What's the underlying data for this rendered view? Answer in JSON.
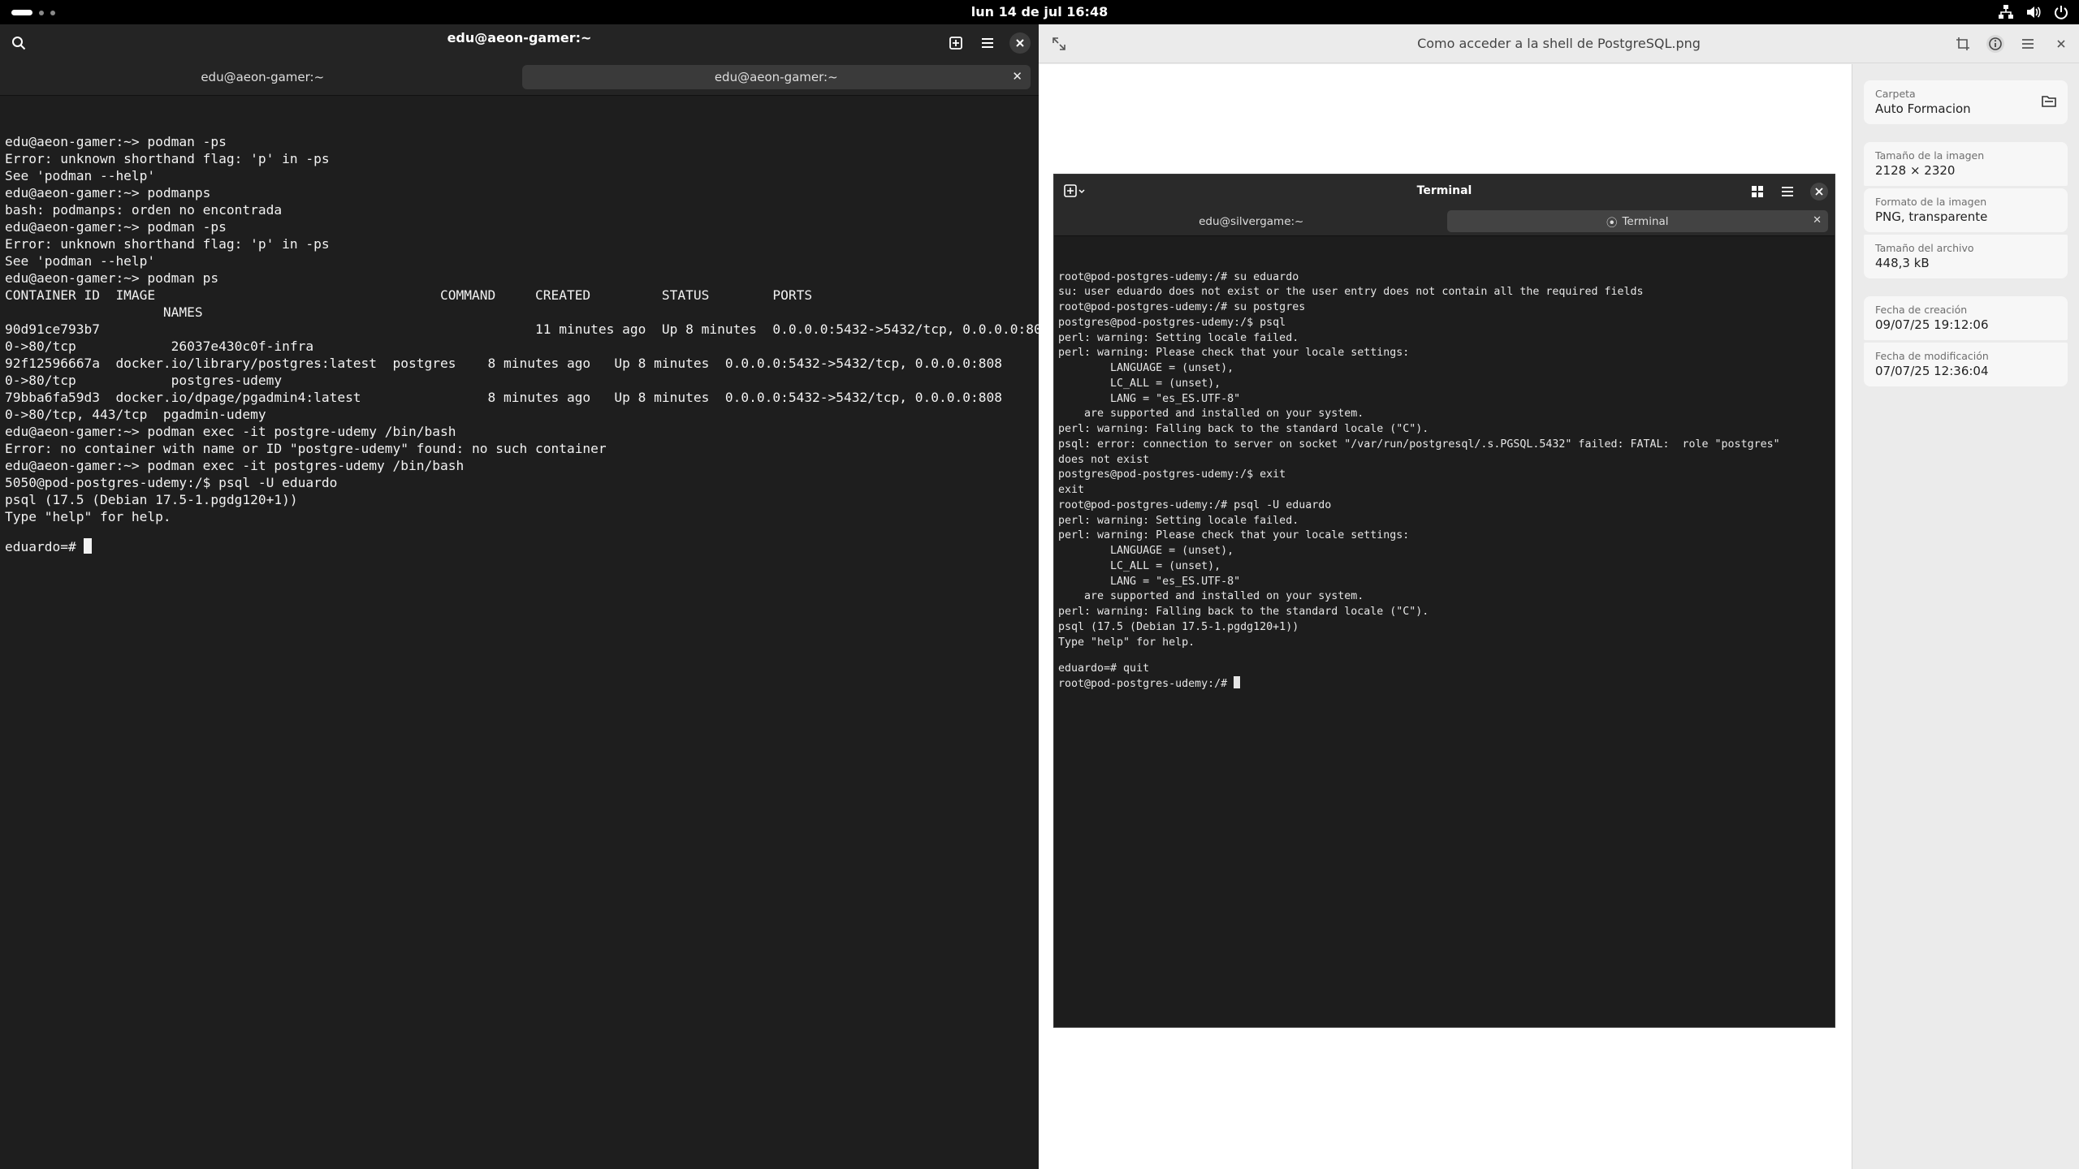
{
  "topbar": {
    "clock": "lun 14 de jul  16:48",
    "icons": [
      "network-icon",
      "volume-icon",
      "power-icon"
    ]
  },
  "terminal": {
    "title": "edu@aeon-gamer:~",
    "tabs": [
      {
        "label": "edu@aeon-gamer:~",
        "active": false
      },
      {
        "label": "edu@aeon-gamer:~",
        "active": true
      }
    ],
    "lines": [
      "edu@aeon-gamer:~> podman -ps",
      "Error: unknown shorthand flag: 'p' in -ps",
      "See 'podman --help'",
      "edu@aeon-gamer:~> podmanps",
      "bash: podmanps: orden no encontrada",
      "edu@aeon-gamer:~> podman -ps",
      "Error: unknown shorthand flag: 'p' in -ps",
      "See 'podman --help'",
      "edu@aeon-gamer:~> podman ps",
      "CONTAINER ID  IMAGE                                    COMMAND     CREATED         STATUS        PORTS",
      "                    NAMES",
      "90d91ce793b7                                                       11 minutes ago  Up 8 minutes  0.0.0.0:5432->5432/tcp, 0.0.0.0:808",
      "0->80/tcp            26037e430c0f-infra",
      "92f12596667a  docker.io/library/postgres:latest  postgres    8 minutes ago   Up 8 minutes  0.0.0.0:5432->5432/tcp, 0.0.0.0:808",
      "0->80/tcp            postgres-udemy",
      "79bba6fa59d3  docker.io/dpage/pgadmin4:latest                8 minutes ago   Up 8 minutes  0.0.0.0:5432->5432/tcp, 0.0.0.0:808",
      "0->80/tcp, 443/tcp  pgadmin-udemy",
      "edu@aeon-gamer:~> podman exec -it postgre-udemy /bin/bash",
      "Error: no container with name or ID \"postgre-udemy\" found: no such container",
      "edu@aeon-gamer:~> podman exec -it postgres-udemy /bin/bash",
      "5050@pod-postgres-udemy:/$ psql -U eduardo",
      "psql (17.5 (Debian 17.5-1.pgdg120+1))",
      "Type \"help\" for help.",
      ""
    ],
    "prompt": "eduardo=# "
  },
  "viewer": {
    "title": "Como acceder a la shell de PostgreSQL.png",
    "folder": {
      "label": "Carpeta",
      "value": "Auto Formacion"
    },
    "image_size": {
      "label": "Tamaño de la imagen",
      "value": "2128 × 2320"
    },
    "image_format": {
      "label": "Formato de la imagen",
      "value": "PNG, transparente"
    },
    "file_size": {
      "label": "Tamaño del archivo",
      "value": "448,3 kB"
    },
    "created": {
      "label": "Fecha de creación",
      "value": "09/07/25 19:12:06"
    },
    "modified": {
      "label": "Fecha de modificación",
      "value": "07/07/25 12:36:04"
    }
  },
  "screenshot": {
    "title": "Terminal",
    "tabs": [
      {
        "label": "edu@silvergame:~",
        "active": false
      },
      {
        "label": "Terminal",
        "active": true
      }
    ],
    "lines": [
      "root@pod-postgres-udemy:/# su eduardo",
      "su: user eduardo does not exist or the user entry does not contain all the required fields",
      "root@pod-postgres-udemy:/# su postgres",
      "postgres@pod-postgres-udemy:/$ psql",
      "perl: warning: Setting locale failed.",
      "perl: warning: Please check that your locale settings:",
      "        LANGUAGE = (unset),",
      "        LC_ALL = (unset),",
      "        LANG = \"es_ES.UTF-8\"",
      "    are supported and installed on your system.",
      "perl: warning: Falling back to the standard locale (\"C\").",
      "psql: error: connection to server on socket \"/var/run/postgresql/.s.PGSQL.5432\" failed: FATAL:  role \"postgres\"",
      "does not exist",
      "postgres@pod-postgres-udemy:/$ exit",
      "exit",
      "root@pod-postgres-udemy:/# psql -U eduardo",
      "perl: warning: Setting locale failed.",
      "perl: warning: Please check that your locale settings:",
      "        LANGUAGE = (unset),",
      "        LC_ALL = (unset),",
      "        LANG = \"es_ES.UTF-8\"",
      "    are supported and installed on your system.",
      "perl: warning: Falling back to the standard locale (\"C\").",
      "psql (17.5 (Debian 17.5-1.pgdg120+1))",
      "Type \"help\" for help.",
      "",
      "eduardo=# quit"
    ],
    "prompt": "root@pod-postgres-udemy:/# "
  }
}
